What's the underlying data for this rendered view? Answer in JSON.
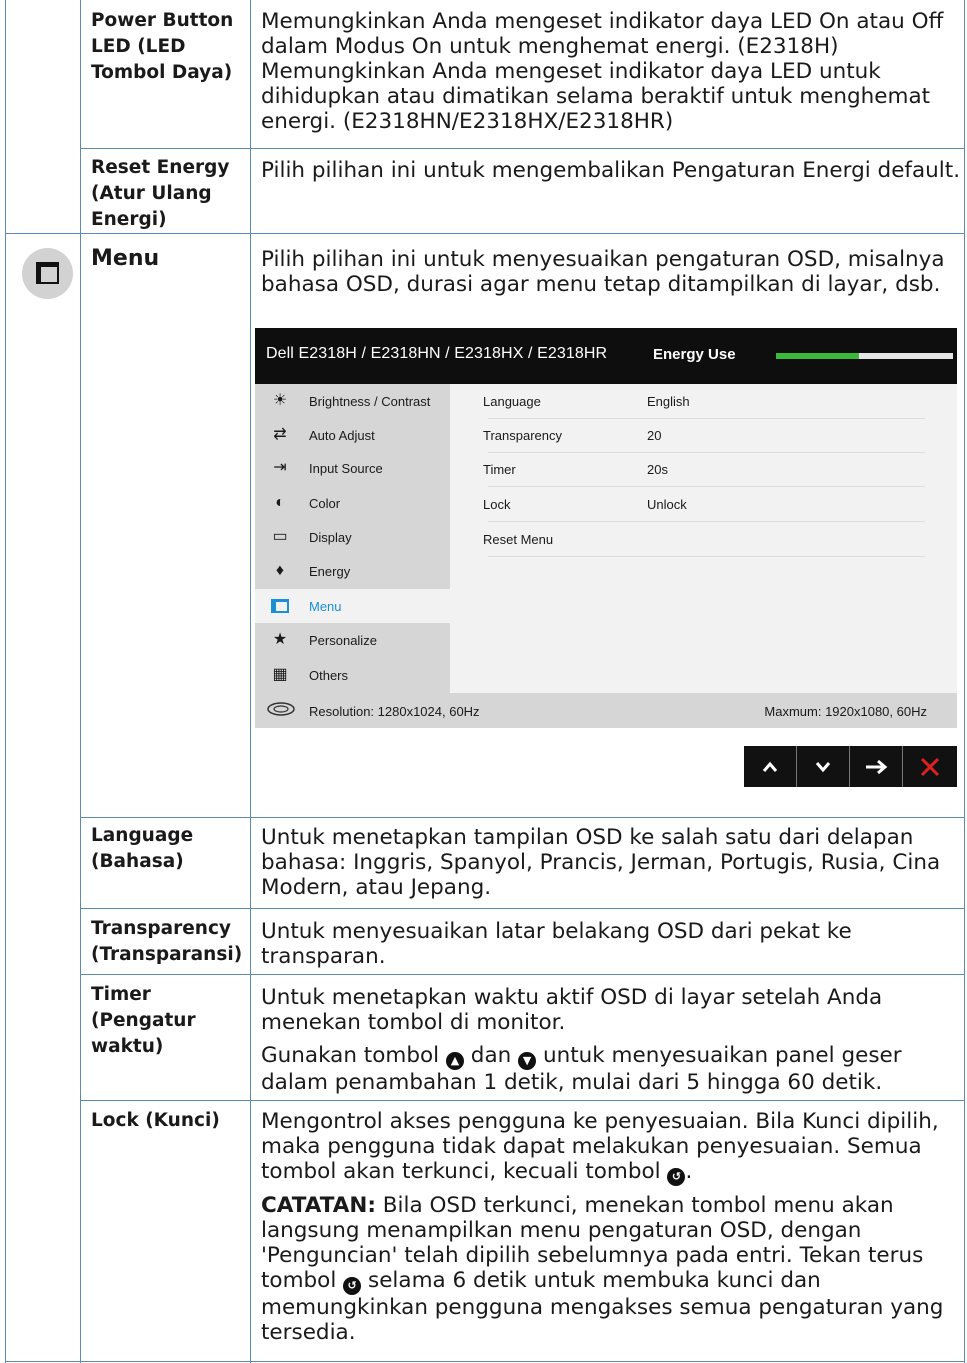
{
  "rows": [
    {
      "head": "Power Button LED (LED Tombol Daya)",
      "desc": [
        "Memungkinkan Anda mengeset indikator daya LED On atau Off dalam Modus On untuk menghemat energi. (E2318H) Memungkinkan Anda mengeset indikator daya LED untuk dihidupkan atau dimatikan selama beraktif untuk menghemat energi. (E2318HN/E2318HX/E2318HR)"
      ]
    },
    {
      "head": "Reset Energy (Atur Ulang Energi)",
      "desc": [
        "Pilih pilihan ini untuk mengembalikan Pengaturan Energi default."
      ]
    }
  ],
  "menu": {
    "title": "Menu",
    "icon": "menu-window-icon",
    "desc": "Pilih pilihan ini untuk menyesuaikan pengaturan OSD, misalnya bahasa OSD, durasi agar menu tetap ditampilkan di layar, dsb."
  },
  "osd": {
    "title": "Dell E2318H / E2318HN / E2318HX / E2318HR",
    "energy_label": "Energy Use",
    "energy_level": 0.47,
    "accent": "#1a8fd6",
    "energy_color": "#3cb83c",
    "items": [
      {
        "label": "Brightness / Contrast",
        "icon": "sun-icon"
      },
      {
        "label": "Auto Adjust",
        "icon": "auto-adjust-icon"
      },
      {
        "label": "Input Source",
        "icon": "input-source-icon"
      },
      {
        "label": "Color",
        "icon": "color-icon"
      },
      {
        "label": "Display",
        "icon": "display-icon"
      },
      {
        "label": "Energy",
        "icon": "energy-icon"
      },
      {
        "label": "Menu",
        "icon": "menu-icon",
        "selected": true
      },
      {
        "label": "Personalize",
        "icon": "star-icon"
      },
      {
        "label": "Others",
        "icon": "others-icon"
      }
    ],
    "settings": [
      {
        "key": "Language",
        "value": "English"
      },
      {
        "key": "Transparency",
        "value": "20"
      },
      {
        "key": "Timer",
        "value": "20s"
      },
      {
        "key": "Lock",
        "value": "Unlock"
      },
      {
        "key": "Reset Menu",
        "value": ""
      }
    ],
    "resolution": "Resolution: 1280x1024, 60Hz",
    "maximum": "Maxmum: 1920x1080, 60Hz",
    "buttons": [
      "up-icon",
      "down-icon",
      "right-arrow-icon",
      "close-icon"
    ]
  },
  "sub_rows": [
    {
      "head": "Language (Bahasa)",
      "desc": [
        "Untuk menetapkan tampilan OSD ke salah satu dari delapan bahasa: Inggris, Spanyol, Prancis, Jerman, Portugis, Rusia, Cina Modern, atau Jepang."
      ]
    },
    {
      "head": "Transparency (Transparansi)",
      "desc": [
        "Untuk menyesuaikan latar belakang OSD dari pekat ke transparan."
      ]
    },
    {
      "head": "Timer (Pengatur waktu)",
      "desc": [
        "Untuk menetapkan waktu aktif OSD di layar setelah Anda menekan tombol di monitor."
      ],
      "desc2_a": "Gunakan tombol",
      "desc2_b": "dan",
      "desc2_c": "untuk menyesuaikan panel geser dalam penambahan 1 detik, mulai dari 5 hingga 60 detik."
    },
    {
      "head": "Lock (Kunci)",
      "desc_a": "Mengontrol akses pengguna ke penyesuaian. Bila Kunci dipilih, maka pengguna tidak dapat melakukan penyesuaian. Semua tombol akan terkunci, kecuali tombol",
      "desc_b": ".",
      "note_label": "CATATAN:",
      "note_a": "Bila OSD terkunci, menekan tombol menu akan langsung menampilkan menu pengaturan OSD, dengan 'Penguncian' telah dipilih sebelumnya pada entri. Tekan terus tombol",
      "note_b": "selama 6 detik untuk membuka kunci dan memungkinkan pengguna mengakses semua pengaturan yang tersedia."
    }
  ]
}
